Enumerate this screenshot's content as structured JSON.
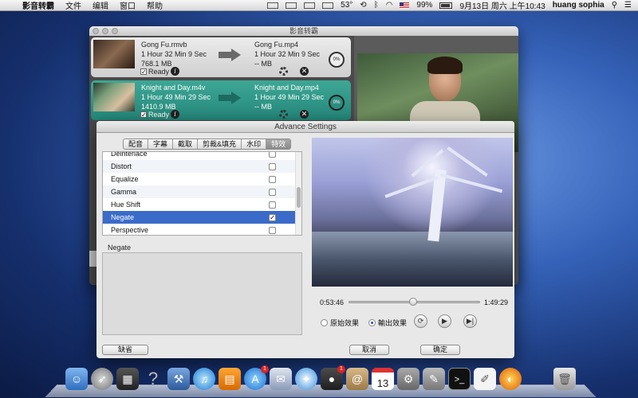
{
  "menubar": {
    "app_name": "影音转霸",
    "menus": [
      "文件",
      "编辑",
      "窗口",
      "帮助"
    ],
    "temperature": "53°",
    "battery": "99%",
    "datetime": "9月13日 周六 上午10:43",
    "user": "huang sophia"
  },
  "main_window": {
    "title": "影音转霸",
    "jobs": [
      {
        "src_name": "Gong Fu.rmvb",
        "src_duration": "1 Hour 32 Min 9 Sec",
        "src_size": "768.1 MB",
        "dst_name": "Gong Fu.mp4",
        "dst_duration": "1 Hour 32 Min 9 Sec",
        "dst_size": "-- MB",
        "ready_label": "Ready",
        "progress": "0%"
      },
      {
        "src_name": "Knight and Day.m4v",
        "src_duration": "1 Hour 49 Min 29 Sec",
        "src_size": "1410.9 MB",
        "dst_name": "Knight and Day.mp4",
        "dst_duration": "1 Hour 49 Min 29 Sec",
        "dst_size": "-- MB",
        "ready_label": "Ready",
        "progress": "0%"
      }
    ]
  },
  "dialog": {
    "title": "Advance Settings",
    "tabs": [
      "配音",
      "字幕",
      "截取",
      "剪裁&填充",
      "水印",
      "特效"
    ],
    "active_tab": "特效",
    "effects": [
      {
        "label": "Deinterlace",
        "checked": false
      },
      {
        "label": "Distort",
        "checked": false
      },
      {
        "label": "Equalize",
        "checked": false
      },
      {
        "label": "Gamma",
        "checked": false
      },
      {
        "label": "Hue Shift",
        "checked": false
      },
      {
        "label": "Negate",
        "checked": true
      },
      {
        "label": "Perspective",
        "checked": false
      }
    ],
    "selected_effect": "Negate",
    "description_title": "Negate",
    "time_current": "0:53:46",
    "time_total": "1:49:29",
    "playhead_fraction": 0.49,
    "radio_original": "原始效果",
    "radio_output": "輸出效果",
    "default_button": "缺省",
    "cancel_button": "取消",
    "ok_button": "确定"
  },
  "dock": {
    "calendar_day": "13",
    "icons": [
      "finder-icon",
      "launchpad-icon",
      "photo-booth-icon",
      "help-icon",
      "xcode-icon",
      "itunes-icon",
      "ibooks-icon",
      "app-store-icon",
      "preview-icon",
      "safari-icon",
      "facetime-icon",
      "contacts-icon",
      "calendar-icon",
      "system-preferences-icon",
      "utilities-icon",
      "terminal-icon",
      "textedit-icon",
      "video-converter-icon",
      "trash-icon"
    ]
  }
}
